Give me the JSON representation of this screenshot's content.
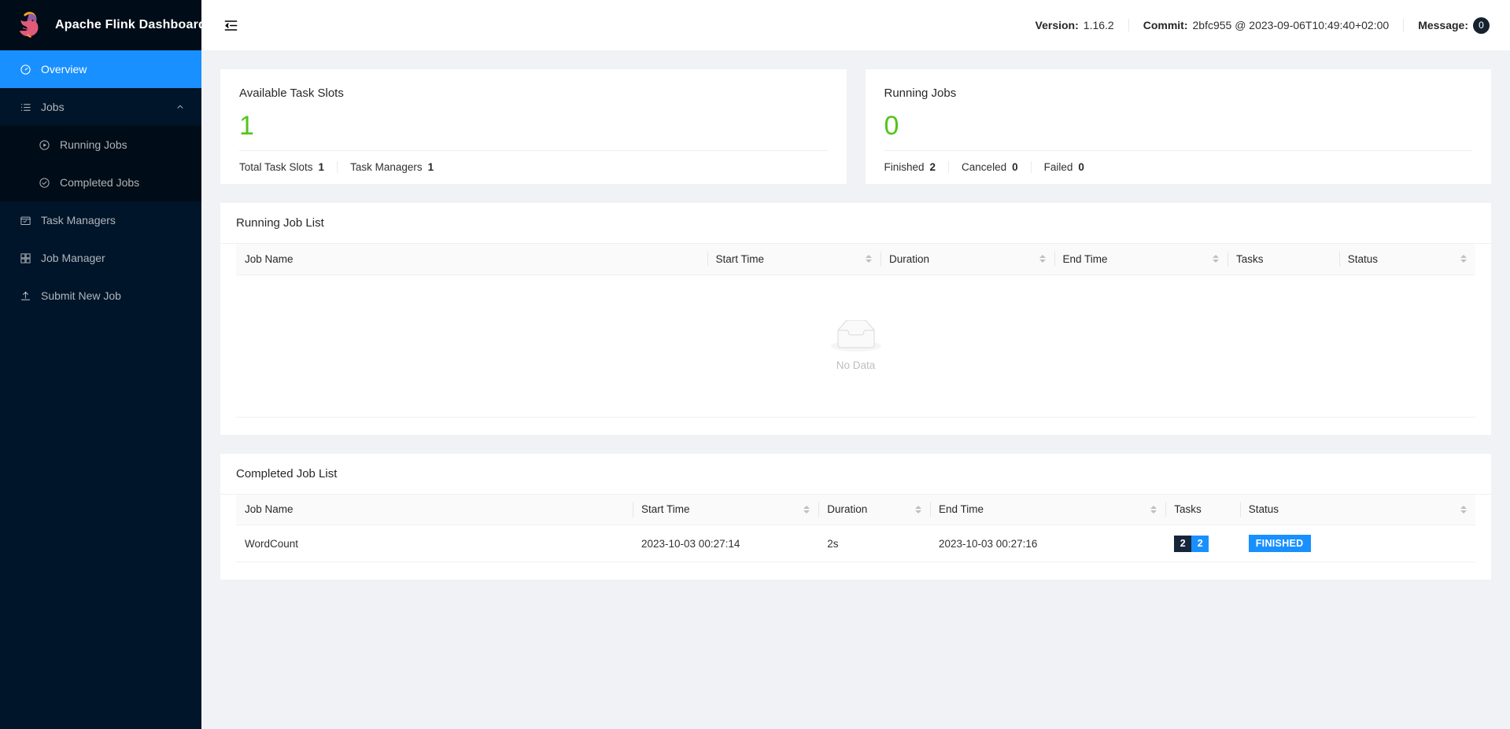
{
  "brand": {
    "title": "Apache Flink Dashboard",
    "logo_icon": "flink-squirrel-logo"
  },
  "sidebar": {
    "items": [
      {
        "label": "Overview",
        "icon": "dashboard-icon",
        "selected": true
      },
      {
        "label": "Jobs",
        "icon": "list-icon",
        "expanded": true
      },
      {
        "label": "Running Jobs",
        "icon": "play-circle-icon",
        "child": true
      },
      {
        "label": "Completed Jobs",
        "icon": "check-circle-icon",
        "child": true
      },
      {
        "label": "Task Managers",
        "icon": "task-manager-icon"
      },
      {
        "label": "Job Manager",
        "icon": "job-manager-icon"
      },
      {
        "label": "Submit New Job",
        "icon": "upload-icon"
      }
    ]
  },
  "topbar": {
    "fold_icon": "menu-fold-icon",
    "version_label": "Version:",
    "version_value": "1.16.2",
    "commit_label": "Commit:",
    "commit_value": "2bfc955 @ 2023-09-06T10:49:40+02:00",
    "message_label": "Message:",
    "message_count": "0"
  },
  "stats": {
    "task_slots": {
      "title": "Available Task Slots",
      "value": "1",
      "value_color": "#52c41a",
      "footer": [
        {
          "label": "Total Task Slots",
          "value": "1"
        },
        {
          "label": "Task Managers",
          "value": "1"
        }
      ]
    },
    "running_jobs": {
      "title": "Running Jobs",
      "value": "0",
      "value_color": "#52c41a",
      "footer": [
        {
          "label": "Finished",
          "value": "2"
        },
        {
          "label": "Canceled",
          "value": "0"
        },
        {
          "label": "Failed",
          "value": "0"
        }
      ]
    }
  },
  "running_job_list": {
    "title": "Running Job List",
    "columns": [
      {
        "label": "Job Name",
        "sortable": false
      },
      {
        "label": "Start Time",
        "sortable": true
      },
      {
        "label": "Duration",
        "sortable": true
      },
      {
        "label": "End Time",
        "sortable": true
      },
      {
        "label": "Tasks",
        "sortable": false
      },
      {
        "label": "Status",
        "sortable": true
      }
    ],
    "rows": [],
    "empty_text": "No Data",
    "empty_icon": "empty-inbox-icon"
  },
  "completed_job_list": {
    "title": "Completed Job List",
    "columns": [
      {
        "label": "Job Name",
        "sortable": false
      },
      {
        "label": "Start Time",
        "sortable": true
      },
      {
        "label": "Duration",
        "sortable": true
      },
      {
        "label": "End Time",
        "sortable": true
      },
      {
        "label": "Tasks",
        "sortable": false
      },
      {
        "label": "Status",
        "sortable": true
      }
    ],
    "rows": [
      {
        "job_name": "WordCount",
        "start_time": "2023-10-03 00:27:14",
        "duration": "2s",
        "end_time": "2023-10-03 00:27:16",
        "tasks_total": "2",
        "tasks_finished": "2",
        "status": "FINISHED",
        "status_color": "#1890ff"
      }
    ]
  }
}
